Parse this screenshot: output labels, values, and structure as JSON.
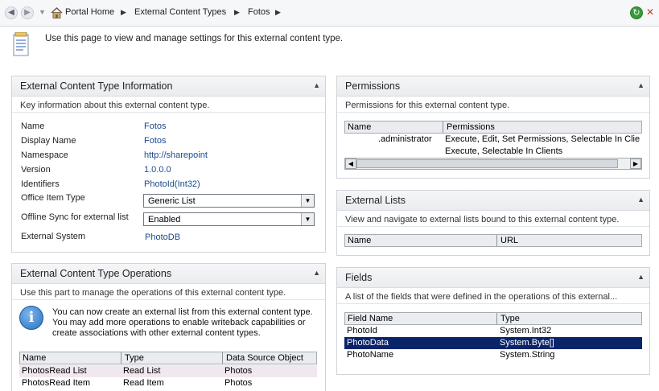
{
  "breadcrumb": {
    "items": [
      "Portal Home",
      "External Content Types",
      "Fotos"
    ],
    "separator": "▶"
  },
  "intro": {
    "text": "Use this page to view and manage settings for this external content type."
  },
  "info_panel": {
    "title": "External Content Type Information",
    "description": "Key information about this external content type.",
    "rows": [
      {
        "label": "Name",
        "value": "Fotos"
      },
      {
        "label": "Display Name",
        "value": "Fotos"
      },
      {
        "label": "Namespace",
        "value": "http://sharepoint"
      },
      {
        "label": "Version",
        "value": "1.0.0.0"
      },
      {
        "label": "Identifiers",
        "value": "PhotoId(Int32)"
      }
    ],
    "office_item_type": {
      "label": "Office Item Type",
      "value": "Generic List"
    },
    "offline_sync": {
      "label": "Offline Sync for external list",
      "value": "Enabled"
    },
    "external_system": {
      "label": "External System",
      "value": "PhotoDB"
    }
  },
  "operations_panel": {
    "title": "External Content Type Operations",
    "description": "Use this part to manage the operations of this external content type.",
    "notice": "You can now create an external list from this external content type. You may add more operations to enable writeback capabilities or create associations with other external content types.",
    "columns": [
      "Name",
      "Type",
      "Data Source Object"
    ],
    "rows": [
      [
        "PhotosRead List",
        "Read List",
        "Photos"
      ],
      [
        "PhotosRead Item",
        "Read Item",
        "Photos"
      ]
    ]
  },
  "permissions_panel": {
    "title": "Permissions",
    "description": "Permissions for this external content type.",
    "columns": [
      "Name",
      "Permissions"
    ],
    "rows": [
      [
        ".administrator",
        "Execute, Edit, Set Permissions, Selectable In Clie"
      ],
      [
        "",
        "Execute, Selectable In Clients"
      ]
    ]
  },
  "external_lists_panel": {
    "title": "External Lists",
    "description": "View and navigate to external lists bound to this external content type.",
    "columns": [
      "Name",
      "URL"
    ]
  },
  "fields_panel": {
    "title": "Fields",
    "description": "A list of the fields that were defined in the operations of this external...",
    "columns": [
      "Field Name",
      "Type"
    ],
    "rows": [
      [
        "PhotoId",
        "System.Int32"
      ],
      [
        "PhotoData",
        "System.Byte[]"
      ],
      [
        "PhotoName",
        "System.String"
      ]
    ],
    "selected_row": 1
  },
  "colors": {
    "link": "#1a4a8c",
    "selection": "#0a246a",
    "highlight_row": "#f0e7ef"
  },
  "icons": [
    "back-icon",
    "forward-icon",
    "home-icon",
    "refresh-icon",
    "stop-icon",
    "page-icon",
    "info-icon",
    "collapse-icon",
    "dropdown-icon"
  ]
}
